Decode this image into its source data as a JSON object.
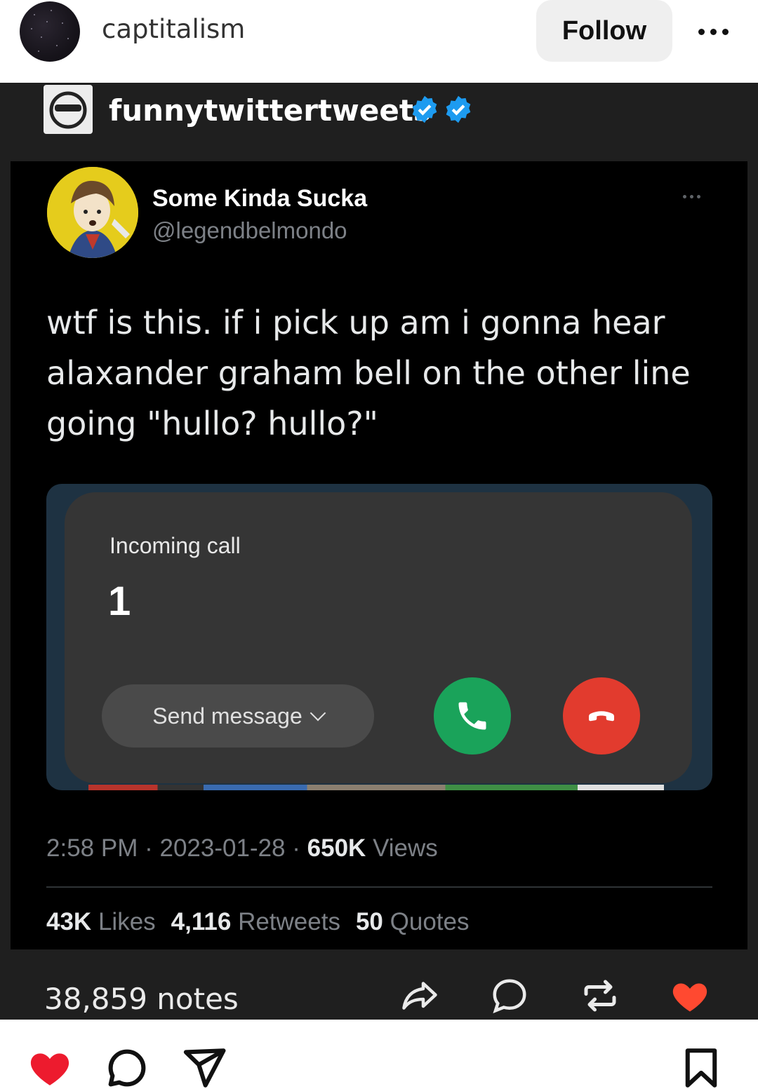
{
  "header": {
    "username": "captitalism",
    "follow_label": "Follow",
    "more_icon": "more-horizontal-icon"
  },
  "post": {
    "source_name": "funnytwittertweets",
    "tweet": {
      "display_name": "Some Kinda Sucka",
      "handle": "@legendbelmondo",
      "text": "wtf is this. if i pick up am i gonna hear alaxander graham bell on the other line going \"hullo? hullo?\"",
      "call_screen": {
        "label": "Incoming call",
        "number": "1",
        "send_message_label": "Send message",
        "accept_color": "#1aa35a",
        "decline_color": "#e23b2e"
      },
      "time": "2:58 PM",
      "date": "2023-01-28",
      "views_count": "650K",
      "views_label": "Views",
      "likes_count": "43K",
      "likes_label": "Likes",
      "retweets_count": "4,116",
      "retweets_label": "Retweets",
      "quotes_count": "50",
      "quotes_label": "Quotes"
    },
    "notes": "38,859 notes",
    "accent_verified": "#1d9bf0",
    "heart_color": "#ff4930"
  },
  "actions": {
    "like_color": "#ed1b2e"
  }
}
